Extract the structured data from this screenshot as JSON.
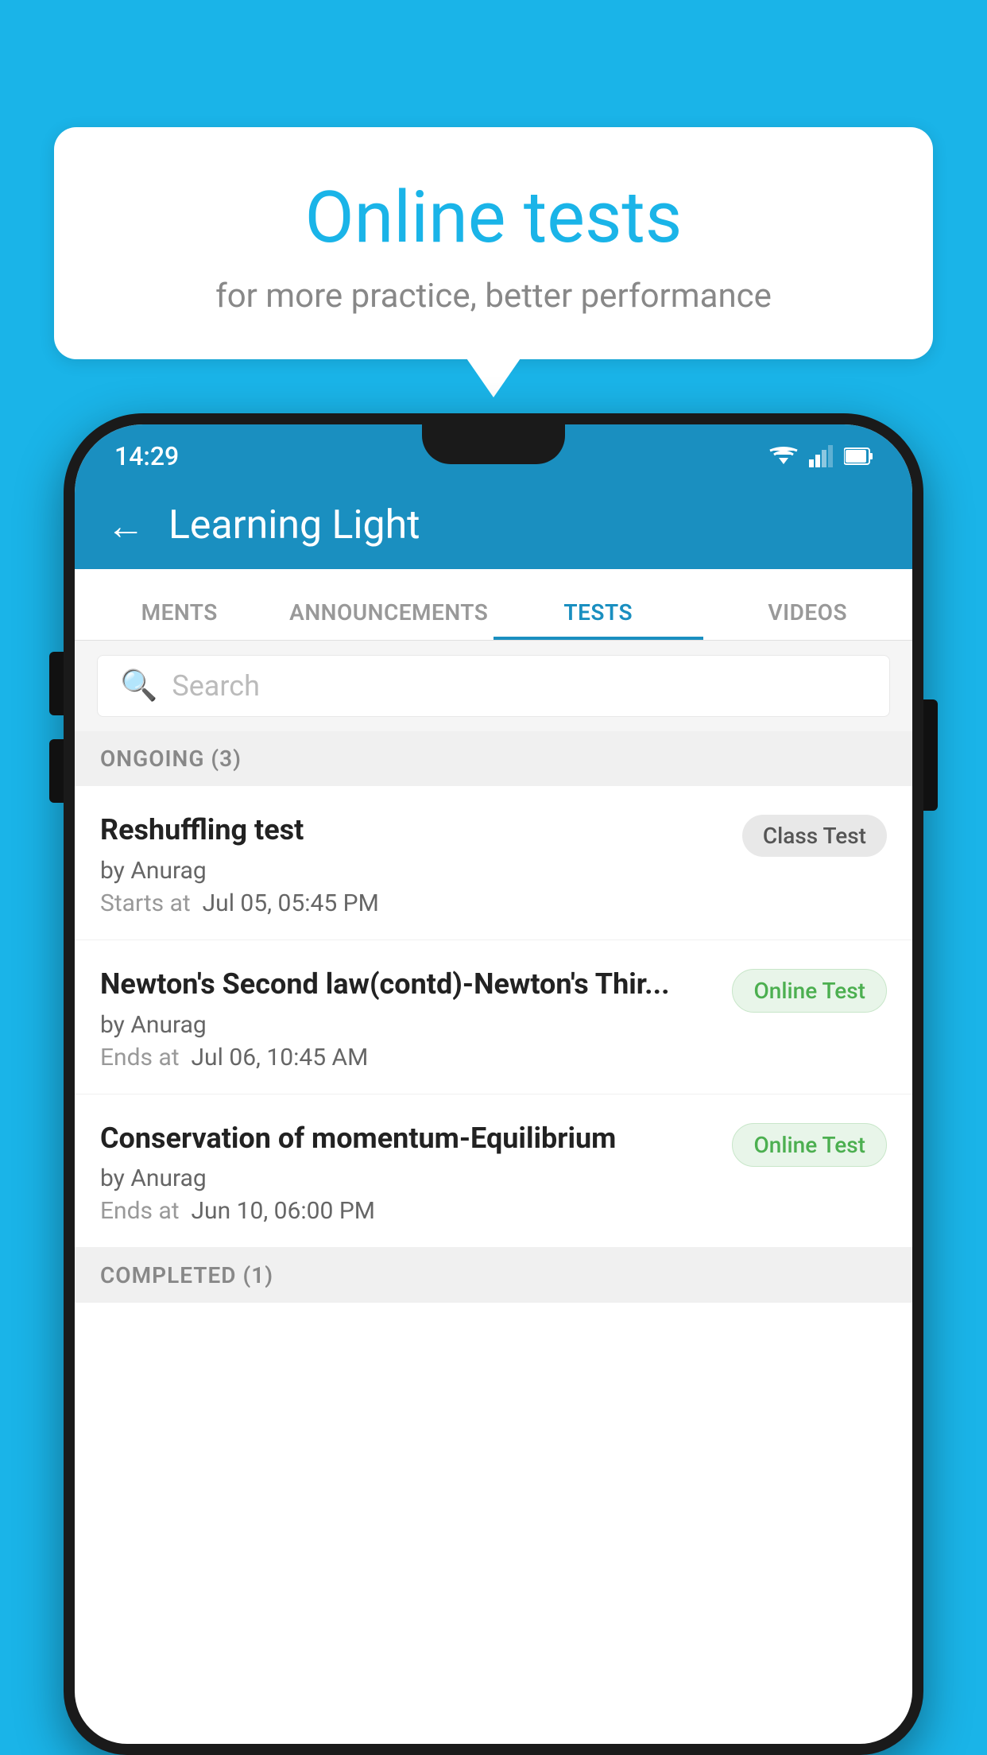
{
  "background_color": "#1ab4e8",
  "speech_bubble": {
    "title": "Online tests",
    "subtitle": "for more practice, better performance"
  },
  "phone": {
    "status_bar": {
      "time": "14:29"
    },
    "app_bar": {
      "title": "Learning Light"
    },
    "tabs": [
      {
        "label": "MENTS",
        "active": false
      },
      {
        "label": "ANNOUNCEMENTS",
        "active": false
      },
      {
        "label": "TESTS",
        "active": true
      },
      {
        "label": "VIDEOS",
        "active": false
      }
    ],
    "search": {
      "placeholder": "Search"
    },
    "ongoing_section": {
      "header": "ONGOING (3)",
      "tests": [
        {
          "name": "Reshuffling test",
          "author": "by Anurag",
          "date_label": "Starts at",
          "date": "Jul 05, 05:45 PM",
          "badge": "Class Test",
          "badge_type": "class"
        },
        {
          "name": "Newton's Second law(contd)-Newton's Thir...",
          "author": "by Anurag",
          "date_label": "Ends at",
          "date": "Jul 06, 10:45 AM",
          "badge": "Online Test",
          "badge_type": "online"
        },
        {
          "name": "Conservation of momentum-Equilibrium",
          "author": "by Anurag",
          "date_label": "Ends at",
          "date": "Jun 10, 06:00 PM",
          "badge": "Online Test",
          "badge_type": "online"
        }
      ]
    },
    "completed_section": {
      "header": "COMPLETED (1)"
    }
  }
}
